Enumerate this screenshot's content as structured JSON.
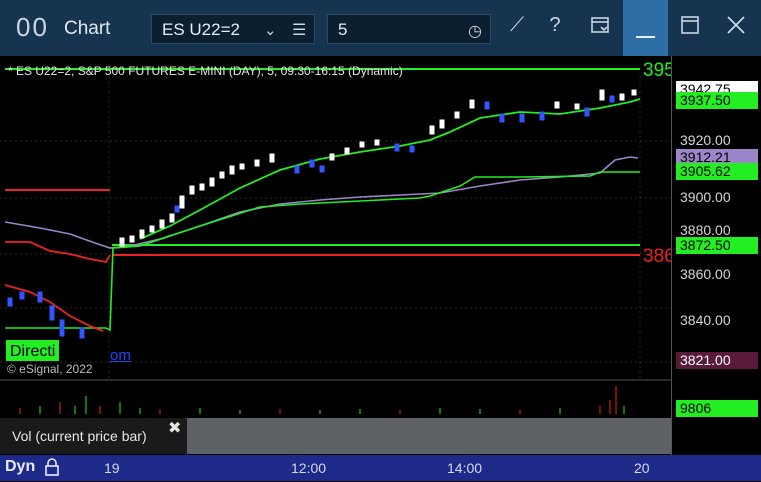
{
  "window": {
    "logo": "00",
    "title": "Chart",
    "symbol_value": "ES U22=2",
    "interval_value": "5"
  },
  "chart": {
    "header": "* ES U22=2, S&P 500 FUTURES E-MINI (DAY), 5, 09:30-16:15 (Dynamic)",
    "watermark": "© eSignal, 2022",
    "direction_label": "Directi",
    "direction_suffix": "om",
    "right_label_green": "395",
    "right_label_red": "386"
  },
  "price_axis": {
    "ticks": [
      "3920.00",
      "3900.00",
      "3880.00",
      "3860.00",
      "3840.00"
    ],
    "tags": [
      {
        "text": "3942.75",
        "bg": "#ffffff",
        "fg": "#000000"
      },
      {
        "text": "3937.50",
        "bg": "#22ee22",
        "fg": "#000000"
      },
      {
        "text": "3912.21",
        "bg": "#9b86c9",
        "fg": "#000000"
      },
      {
        "text": "3905.62",
        "bg": "#22ee22",
        "fg": "#000000"
      },
      {
        "text": "3872.50",
        "bg": "#22ee22",
        "fg": "#000000"
      },
      {
        "text": "3821.00",
        "bg": "#5a1a3a",
        "fg": "#ffffff"
      },
      {
        "text": "9806",
        "bg": "#22ee22",
        "fg": "#000000"
      }
    ]
  },
  "volume_panel": {
    "label": "Vol (current price bar)",
    "close_icon": "✖"
  },
  "time_axis": {
    "mode_label": "Dyn",
    "labels": [
      "19",
      "12:00",
      "14:00",
      "20"
    ]
  },
  "colors": {
    "title_bar": "#16344f",
    "accent_green": "#22ee22",
    "accent_red": "#ee2222",
    "time_axis_bg": "#1d2a8a"
  }
}
